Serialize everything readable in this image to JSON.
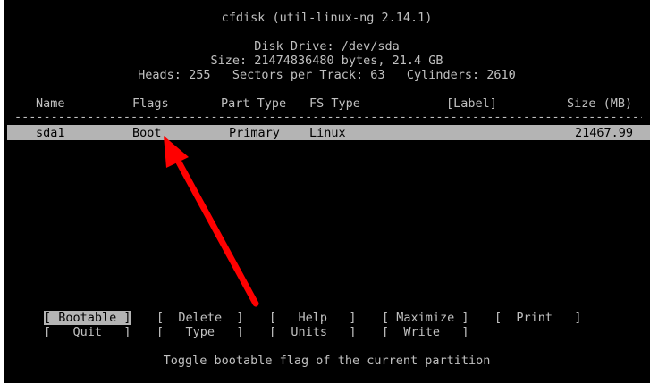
{
  "app": {
    "title": "cfdisk (util-linux-ng 2.14.1)"
  },
  "disk": {
    "drive_line": "Disk Drive: /dev/sda",
    "size_line": "Size: 21474836480 bytes, 21.4 GB",
    "geometry_line": "Heads: 255   Sectors per Track: 63   Cylinders: 2610"
  },
  "table": {
    "headers": {
      "name": "Name",
      "flags": "Flags",
      "part_type": "Part Type",
      "fs_type": "FS Type",
      "label": "[Label]",
      "size": "Size (MB)"
    },
    "divider": "----------------------------------------------------------------------------------------------------------------------",
    "rows": [
      {
        "name": "sda1",
        "flags": "Boot",
        "part_type": "Primary",
        "fs_type": "Linux",
        "label": "",
        "size": "21467.99",
        "selected": true
      }
    ]
  },
  "menu": {
    "row1": [
      {
        "label": "[ Bootable ]",
        "active": true
      },
      {
        "label": "[  Delete  ]",
        "active": false
      },
      {
        "label": "[   Help   ]",
        "active": false
      },
      {
        "label": "[ Maximize ]",
        "active": false
      },
      {
        "label": "[  Print   ]",
        "active": false
      }
    ],
    "row2": [
      {
        "label": "[   Quit   ]",
        "active": false
      },
      {
        "label": "[   Type   ]",
        "active": false
      },
      {
        "label": "[  Units   ]",
        "active": false
      },
      {
        "label": "[  Write   ]",
        "active": false
      }
    ]
  },
  "status": {
    "hint": "Toggle bootable flag of the current partition"
  },
  "colors": {
    "background": "#000000",
    "text": "#c0c0c0",
    "highlight": "#b4b4b4",
    "annotation_arrow": "#ff0000"
  },
  "annotation": {
    "icon": "red-arrow-icon"
  }
}
